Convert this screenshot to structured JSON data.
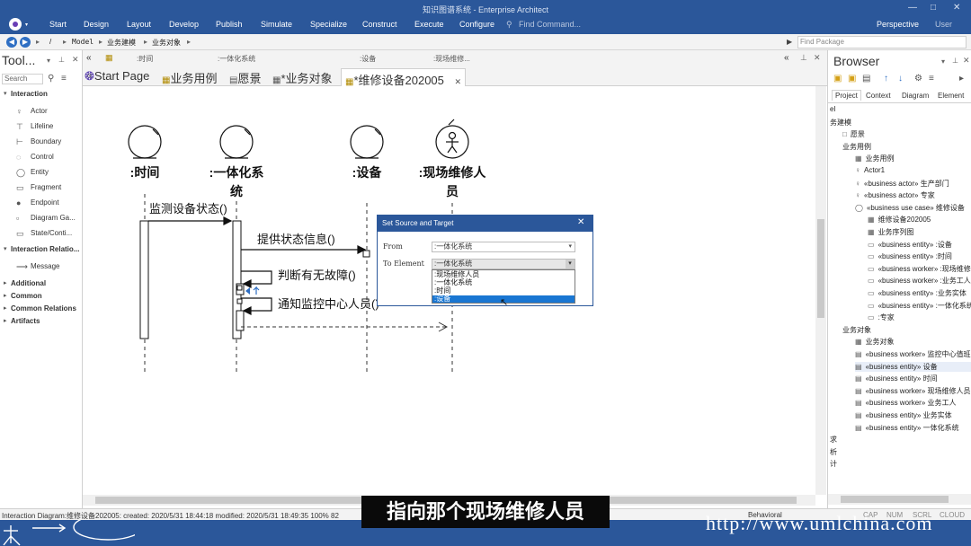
{
  "app": {
    "title": "知识图谱系统 - Enterprise Architect",
    "menu": [
      "Start",
      "Design",
      "Layout",
      "Develop",
      "Publish",
      "Simulate",
      "Specialize",
      "Construct",
      "Execute",
      "Configure"
    ],
    "find_command": "Find Command...",
    "perspective": "Perspective",
    "user": "User"
  },
  "breadcrumb": {
    "items": [
      "/",
      "Model",
      "业务建模",
      "业务对象"
    ],
    "find_package_placeholder": "Find Package"
  },
  "toolbox": {
    "title": "Tool...",
    "search_placeholder": "Search",
    "interaction_header": "Interaction",
    "interaction_items": [
      "Actor",
      "Lifeline",
      "Boundary",
      "Control",
      "Entity",
      "Fragment",
      "Endpoint",
      "Diagram Ga...",
      "State/Conti..."
    ],
    "relations_header": "Interaction Relatio...",
    "relations_items": [
      "Message"
    ],
    "sections": [
      "Additional",
      "Common",
      "Common Relations",
      "Artifacts"
    ]
  },
  "tab_header": {
    "items": [
      ":时间",
      ":一体化系统",
      ":设备",
      ":现场维修..."
    ]
  },
  "tabs": [
    "Start Page",
    "业务用例",
    "愿景",
    "*业务对象",
    "*维修设备202005"
  ],
  "diagram": {
    "lifelines": [
      ":时间",
      ":一体化系统",
      ":设备",
      ":现场维修人员"
    ],
    "messages": [
      "监测设备状态()",
      "提供状态信息()",
      "判断有无故障()",
      "通知监控中心人员()"
    ]
  },
  "dialog": {
    "title": "Set Source and Target",
    "from_label": "From",
    "from_value": ":一体化系统",
    "to_label": "To Element",
    "to_value": ":一体化系统",
    "options": [
      ":现场维修人员",
      ":一体化系统",
      ":时间",
      ":设备"
    ],
    "selected_index": 3
  },
  "browser": {
    "title": "Browser",
    "tabs": [
      "Project",
      "Context",
      "Diagram",
      "Element"
    ],
    "tree": [
      {
        "text": "el",
        "indent": 0,
        "icon": ""
      },
      {
        "text": "务建模",
        "indent": 0,
        "icon": ""
      },
      {
        "text": "愿景",
        "indent": 1,
        "icon": "□"
      },
      {
        "text": "业务用例",
        "indent": 1,
        "icon": ""
      },
      {
        "text": "业务用例",
        "indent": 2,
        "icon": "▦"
      },
      {
        "text": "Actor1",
        "indent": 2,
        "icon": "♀"
      },
      {
        "text": "«business actor» 生产部门",
        "indent": 2,
        "icon": "♀"
      },
      {
        "text": "«business actor» 专家",
        "indent": 2,
        "icon": "♀"
      },
      {
        "text": "«business use case» 维修设备",
        "indent": 2,
        "icon": "◯"
      },
      {
        "text": "维修设备202005",
        "indent": 3,
        "icon": "▦"
      },
      {
        "text": "业务序列图",
        "indent": 3,
        "icon": "▦"
      },
      {
        "text": "«business entity» :设备",
        "indent": 3,
        "icon": "▭"
      },
      {
        "text": "«business entity» :时间",
        "indent": 3,
        "icon": "▭"
      },
      {
        "text": "«business worker» :现场维修人",
        "indent": 3,
        "icon": "▭"
      },
      {
        "text": "«business worker» :业务工人",
        "indent": 3,
        "icon": "▭"
      },
      {
        "text": "«business entity» :业务实体",
        "indent": 3,
        "icon": "▭"
      },
      {
        "text": "«business entity» :一体化系统",
        "indent": 3,
        "icon": "▭"
      },
      {
        "text": ":专家",
        "indent": 3,
        "icon": "▭"
      },
      {
        "text": "业务对象",
        "indent": 1,
        "icon": ""
      },
      {
        "text": "业务对象",
        "indent": 2,
        "icon": "▦"
      },
      {
        "text": "«business worker» 监控中心值班人",
        "indent": 2,
        "icon": "▤"
      },
      {
        "text": "«business entity» 设备",
        "indent": 2,
        "icon": "▤"
      },
      {
        "text": "«business entity» 时间",
        "indent": 2,
        "icon": "▤"
      },
      {
        "text": "«business worker» 现场维修人员",
        "indent": 2,
        "icon": "▤"
      },
      {
        "text": "«business worker» 业务工人",
        "indent": 2,
        "icon": "▤"
      },
      {
        "text": "«business entity» 业务实体",
        "indent": 2,
        "icon": "▤"
      },
      {
        "text": "«business entity» 一体化系统",
        "indent": 2,
        "icon": "▤"
      },
      {
        "text": "求",
        "indent": 0,
        "icon": ""
      },
      {
        "text": "析",
        "indent": 0,
        "icon": ""
      },
      {
        "text": "计",
        "indent": 0,
        "icon": ""
      }
    ]
  },
  "status": {
    "text": "Interaction Diagram:维修设备202005:   created: 2020/5/31 18:44:18  modified: 2020/5/31 18:49:35   100%   82",
    "mode": "Behavioral",
    "indicators": [
      "CAP",
      "NUM",
      "SCRL",
      "CLOUD"
    ]
  },
  "subtitle": "指向那个现场维修人员",
  "watermark": "http://www.umlchina.com"
}
